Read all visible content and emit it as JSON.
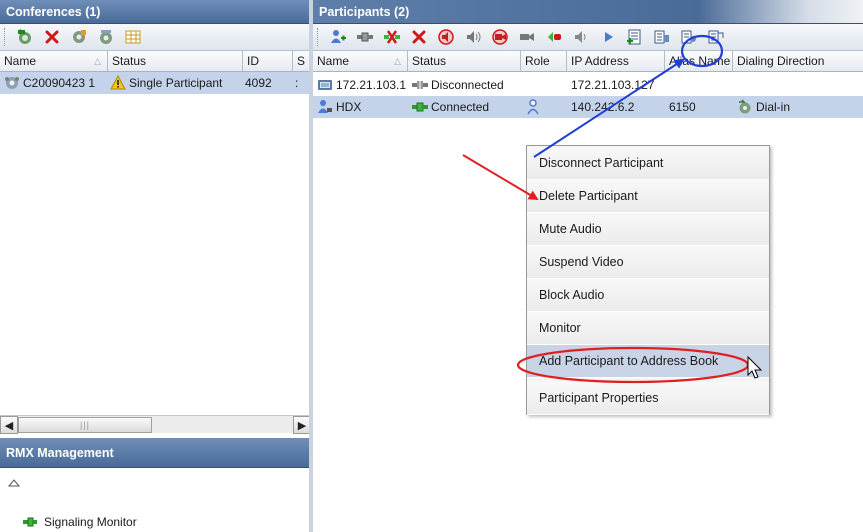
{
  "conferences": {
    "title": "Conferences (1)",
    "toolbar": [
      "new-conference-icon",
      "delete-icon",
      "conference-tools-icon",
      "conference-settings-icon",
      "grid-icon"
    ],
    "columns": [
      {
        "label": "Name"
      },
      {
        "label": "Status"
      },
      {
        "label": "ID"
      },
      {
        "label": "S"
      }
    ],
    "rows": [
      {
        "name": "C20090423 1",
        "status": "Single Participant",
        "id": "4092",
        "extra": ":"
      }
    ]
  },
  "rmx": {
    "title": "RMX Management",
    "items": [
      {
        "label": "Signaling Monitor"
      }
    ]
  },
  "participants": {
    "title": "Participants (2)",
    "columns": [
      {
        "label": "Name"
      },
      {
        "label": "Status"
      },
      {
        "label": "Role"
      },
      {
        "label": "IP Address"
      },
      {
        "label": "Alias Name"
      },
      {
        "label": "Dialing Direction"
      }
    ],
    "rows": [
      {
        "name": "172.21.103.1",
        "status": "Disconnected",
        "role": "",
        "ip": "172.21.103.127",
        "alias": "",
        "dialing": ""
      },
      {
        "name": "HDX",
        "status": "Connected",
        "role": "",
        "ip": "140.242.6.2",
        "alias": "6150",
        "dialing": "Dial-in"
      }
    ]
  },
  "context_menu": {
    "items": [
      {
        "label": "Disconnect Participant"
      },
      {
        "label": "Delete Participant"
      },
      {
        "label": "Mute Audio"
      },
      {
        "label": "Suspend Video"
      },
      {
        "label": "Block Audio"
      },
      {
        "label": "Monitor"
      },
      {
        "label": "Add Participant to Address Book"
      },
      {
        "label": "Participant Properties"
      }
    ]
  },
  "colors": {
    "title_bar": "#4a6b98",
    "selection": "#c5d3ea",
    "annotation_blue": "#1f3fd6",
    "annotation_red": "#e02020",
    "connected": "#2e9a2e"
  }
}
